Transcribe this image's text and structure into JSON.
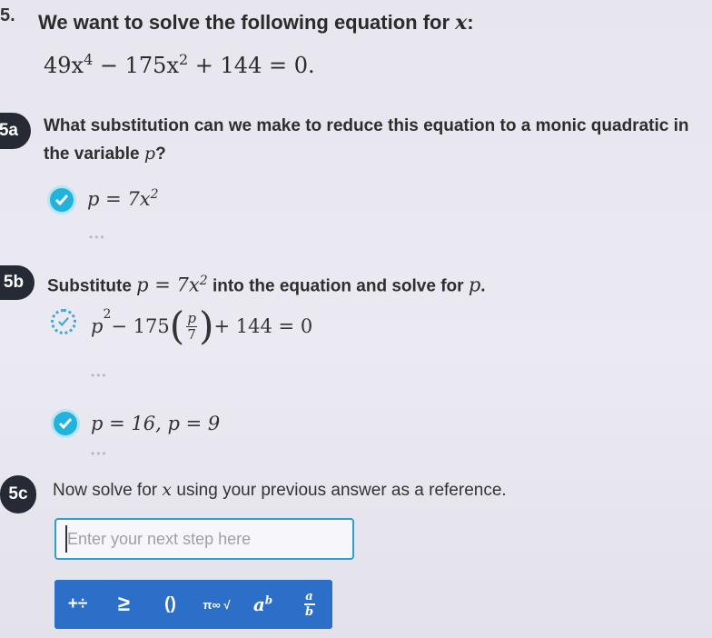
{
  "question": {
    "number": "5.",
    "text": "We want to solve the following equation for ",
    "variable": "x",
    "colon": ":",
    "equation": {
      "c1": "49x",
      "e1": "4",
      "op1": " − 175x",
      "e2": "2",
      "rest": " + 144 = 0."
    }
  },
  "step_a": {
    "badge": "5a",
    "prompt": "What substitution can we make to reduce this equation to a monic quadratic in the variable ",
    "var": "p",
    "qmark": "?",
    "answer": {
      "lhs": "p = 7x",
      "exp": "2"
    },
    "status": "correct",
    "dots": "•••"
  },
  "step_b": {
    "badge": "5b",
    "prompt_start": "Substitute ",
    "sub_lhs": "p = 7x",
    "sub_exp": "2",
    "prompt_end": " into the equation and solve for ",
    "var": "p",
    "period": ".",
    "work": {
      "p": "p",
      "pexp": "2",
      "minus": " − 175",
      "num": "p",
      "den": "7",
      "rest": " + 144 = 0"
    },
    "dots1": "•••",
    "answer": "p = 16, p = 9",
    "dots2": "•••"
  },
  "step_c": {
    "badge": "5c",
    "prompt_start": "Now solve for ",
    "var": "x",
    "prompt_end": " using your previous answer as a reference.",
    "input_value": "",
    "input_placeholder": "Enter your next step here"
  },
  "toolbar": {
    "background": "#2b6fc9",
    "buttons": [
      {
        "icon": "operators-icon",
        "label": "+÷"
      },
      {
        "icon": "inequality-icon",
        "label": "≥"
      },
      {
        "icon": "parentheses-icon",
        "label": "()"
      },
      {
        "icon": "symbols-icon",
        "label": "π∞ √"
      },
      {
        "icon": "exponent-icon",
        "label": "a",
        "sup": "b"
      },
      {
        "icon": "fraction-icon",
        "num": "a",
        "den": "b"
      }
    ]
  },
  "colors": {
    "accent": "#22b3dd",
    "badge": "#262a35",
    "input_border": "#2f9dd0"
  }
}
